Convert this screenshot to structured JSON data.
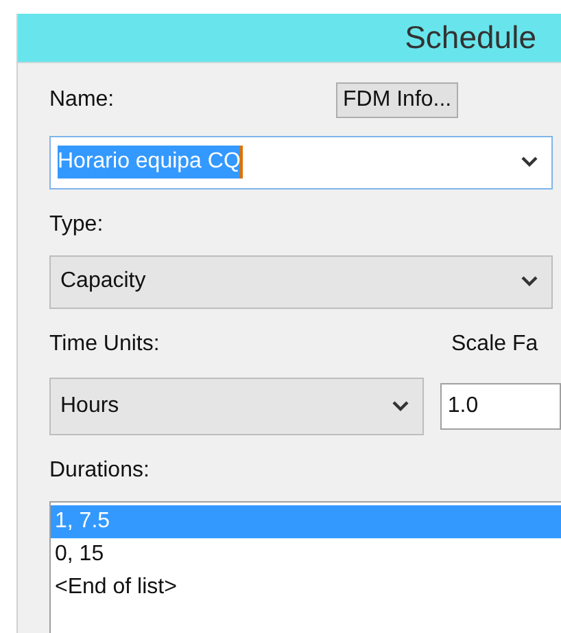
{
  "window": {
    "title": "Schedule"
  },
  "name": {
    "label": "Name:",
    "value": "Horario equipa CQ",
    "text_selected": true,
    "button": "FDM Info..."
  },
  "type": {
    "label": "Type:",
    "value": "Capacity"
  },
  "time_units": {
    "label": "Time Units:",
    "value": "Hours"
  },
  "scale_factor": {
    "label": "Scale Fa",
    "value": "1.0"
  },
  "durations": {
    "label": "Durations:",
    "items": [
      {
        "text": "1, 7.5",
        "selected": true
      },
      {
        "text": "0, 15",
        "selected": false
      },
      {
        "text": "<End of list>",
        "selected": false
      }
    ]
  }
}
